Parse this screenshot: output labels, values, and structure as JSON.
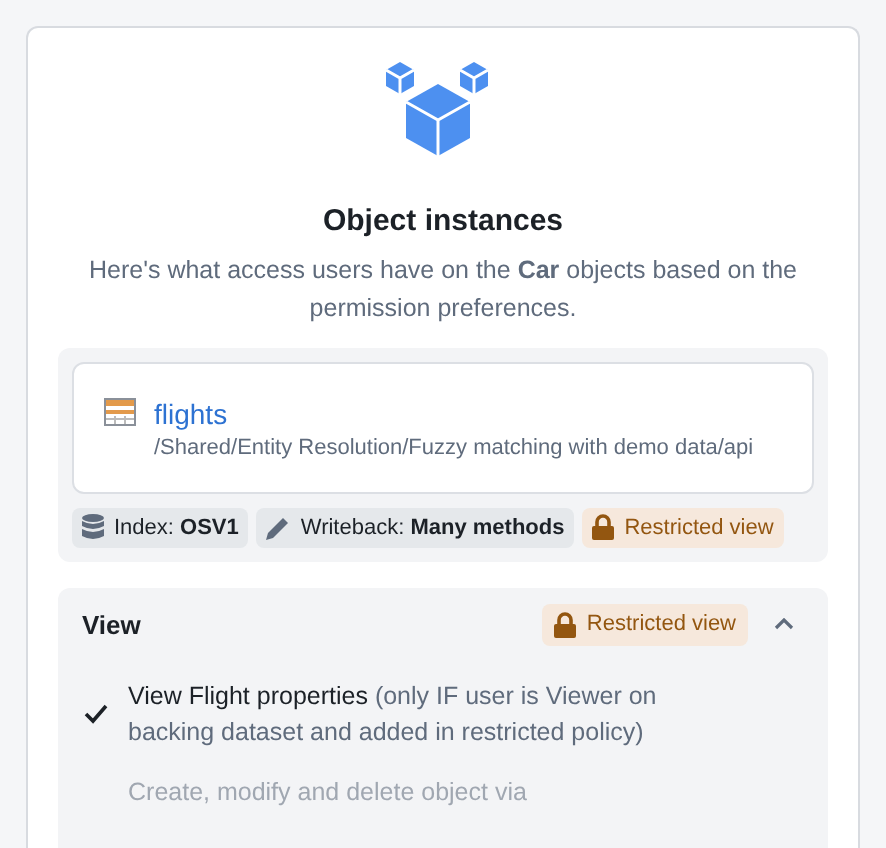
{
  "header": {
    "title": "Object instances",
    "description": "Here's what access users have on the **Car** objects based on the permission preferences."
  },
  "datasource": {
    "name": "flights",
    "path": "/Shared/Entity Resolution/Fuzzy matching with demo data/api"
  },
  "tags": [
    {
      "kind": "index",
      "label": "Index:",
      "value": "OSV1"
    },
    {
      "kind": "writeback",
      "label": "Writeback:",
      "value": "Many methods"
    },
    {
      "kind": "restricted",
      "label": "Restricted view"
    }
  ],
  "section": {
    "title": "View",
    "badge": "Restricted view",
    "expanded": true,
    "permissions": [
      {
        "label": "View Flight properties",
        "note": " (only IF user is Viewer on backing dataset and added in restricted policy)",
        "granted": true
      },
      {
        "label": "Create, modify and delete object via",
        "granted": false
      }
    ]
  }
}
